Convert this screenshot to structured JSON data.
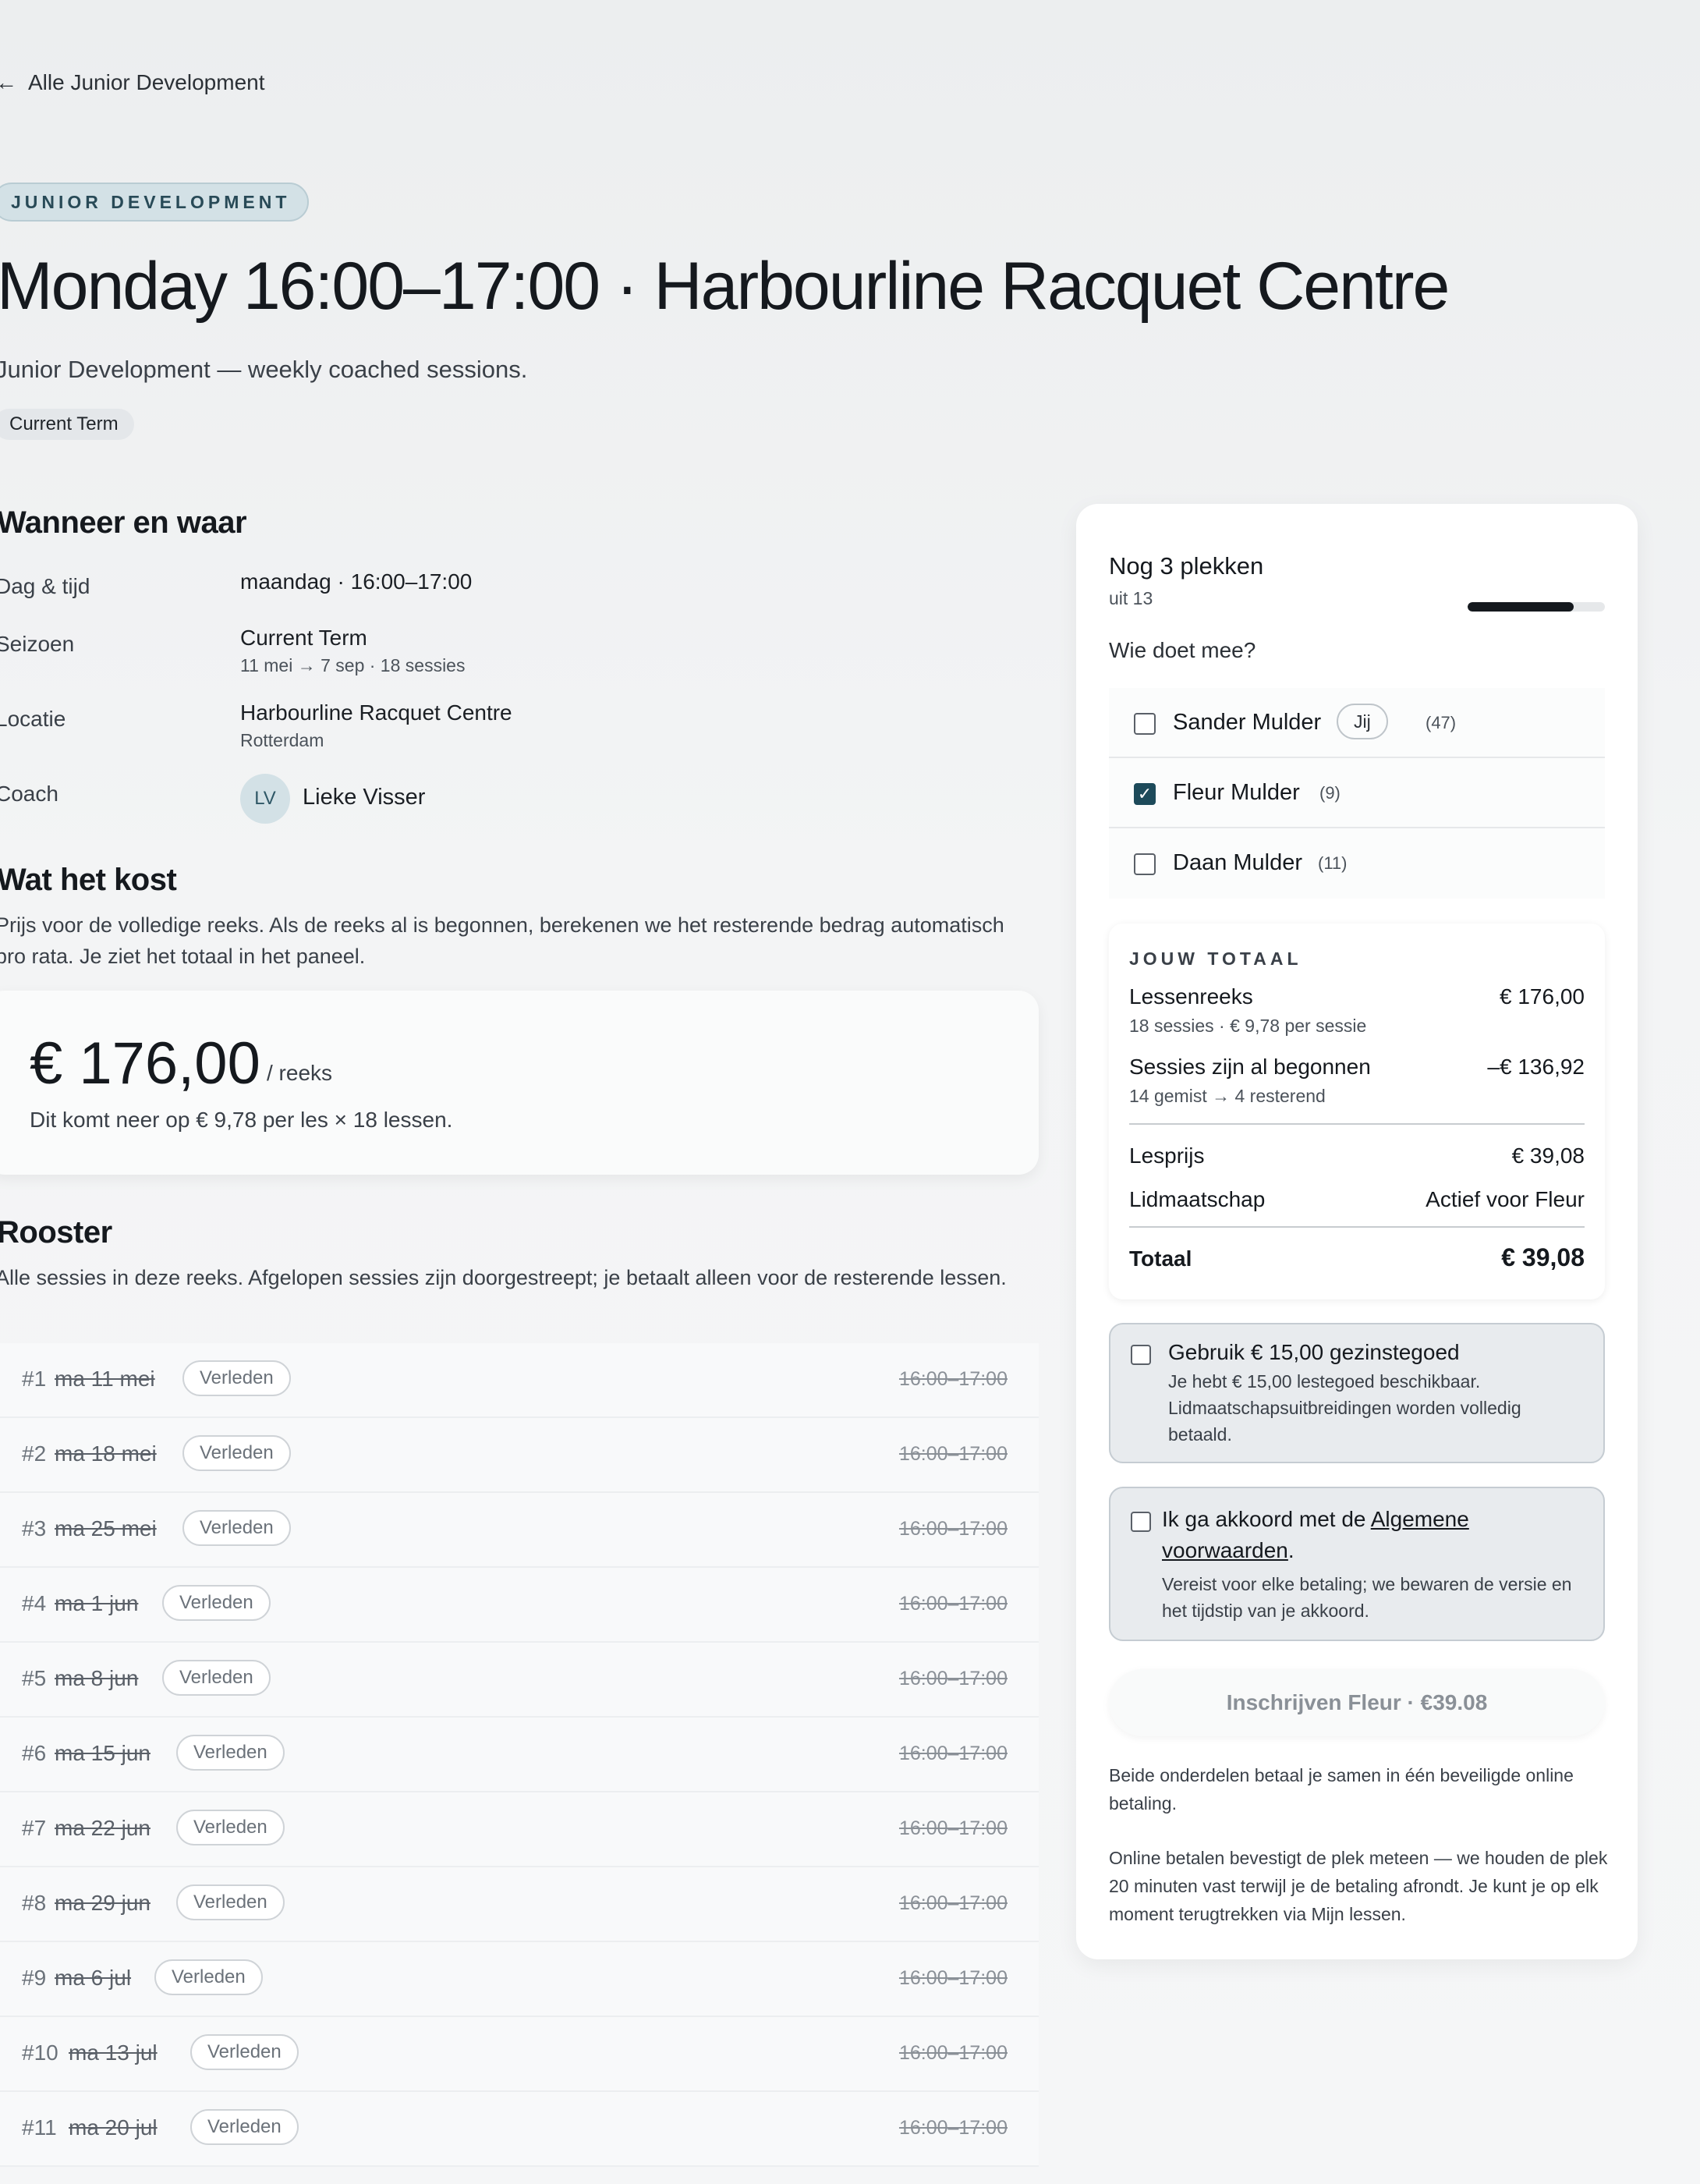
{
  "nav": {
    "back_label": "Alle Junior Development"
  },
  "header": {
    "eyebrow": "JUNIOR DEVELOPMENT",
    "title": "Monday 16:00–17:00 · Harbourline Racquet Centre",
    "subtitle": "Junior Development — weekly coached sessions.",
    "term_chip": "Current Term"
  },
  "when_where": {
    "heading": "Wanneer en waar",
    "day_label": "Dag & tijd",
    "day_value": "maandag · 16:00–17:00",
    "season_label": "Seizoen",
    "season_value": "Current Term",
    "season_sub": "11 mei → 7 sep · 18 sessies",
    "location_label": "Locatie",
    "location_value": "Harbourline Racquet Centre",
    "location_sub": "Rotterdam",
    "coach_label": "Coach",
    "coach_initials": "LV",
    "coach_name": "Lieke Visser"
  },
  "cost": {
    "heading": "Wat het kost",
    "description": "Prijs voor de volledige reeks. Als de reeks al is begonnen, berekenen we het resterende bedrag automatisch pro rata. Je ziet het totaal in het paneel.",
    "price": "€ 176,00",
    "unit": "/ reeks",
    "note": "Dit komt neer op € 9,78 per les × 18 lessen."
  },
  "schedule": {
    "heading": "Rooster",
    "description": "Alle sessies in deze reeks. Afgelopen sessies zijn doorgestreept; je betaalt alleen voor de resterende lessen.",
    "rows": [
      {
        "num": "#1",
        "date": "ma 11 mei",
        "badge": "Verleden",
        "time": "16:00–17:00"
      },
      {
        "num": "#2",
        "date": "ma 18 mei",
        "badge": "Verleden",
        "time": "16:00–17:00"
      },
      {
        "num": "#3",
        "date": "ma 25 mei",
        "badge": "Verleden",
        "time": "16:00–17:00"
      },
      {
        "num": "#4",
        "date": "ma 1 jun",
        "badge": "Verleden",
        "time": "16:00–17:00"
      },
      {
        "num": "#5",
        "date": "ma 8 jun",
        "badge": "Verleden",
        "time": "16:00–17:00"
      },
      {
        "num": "#6",
        "date": "ma 15 jun",
        "badge": "Verleden",
        "time": "16:00–17:00"
      },
      {
        "num": "#7",
        "date": "ma 22 jun",
        "badge": "Verleden",
        "time": "16:00–17:00"
      },
      {
        "num": "#8",
        "date": "ma 29 jun",
        "badge": "Verleden",
        "time": "16:00–17:00"
      },
      {
        "num": "#9",
        "date": "ma 6 jul",
        "badge": "Verleden",
        "time": "16:00–17:00"
      },
      {
        "num": "#10",
        "date": "ma 13 jul",
        "badge": "Verleden",
        "time": "16:00–17:00"
      },
      {
        "num": "#11",
        "date": "ma 20 jul",
        "badge": "Verleden",
        "time": "16:00–17:00"
      }
    ]
  },
  "panel": {
    "spots_title": "Nog 3 plekken",
    "spots_sub": "uit 13",
    "spots_fill_fraction": 0.77,
    "who_label": "Wie doet mee?",
    "members": [
      {
        "name": "Sander Mulder",
        "tag": "Jij",
        "age": "(47)",
        "checked": false
      },
      {
        "name": "Fleur Mulder",
        "tag": "",
        "age": "(9)",
        "checked": true
      },
      {
        "name": "Daan Mulder",
        "tag": "",
        "age": "(11)",
        "checked": false
      }
    ],
    "total": {
      "eyebrow": "JOUW TOTAAL",
      "series_label": "Lessenreeks",
      "series_value": "€ 176,00",
      "series_sub": "18 sessies · € 9,78 per sessie",
      "started_label": "Sessies zijn al begonnen",
      "started_value": "–€ 136,92",
      "started_sub": "14 gemist → 4 resterend",
      "lesson_label": "Lesprijs",
      "lesson_value": "€ 39,08",
      "membership_label": "Lidmaatschap",
      "membership_value": "Actief voor Fleur",
      "total_label": "Totaal",
      "total_value": "€ 39,08"
    },
    "credit": {
      "title": "Gebruik € 15,00 gezinstegoed",
      "text": "Je hebt € 15,00 lestegoed beschikbaar. Lidmaatschapsuitbreidingen worden volledig betaald."
    },
    "terms": {
      "prefix": "Ik ga akkoord met de ",
      "link": "Algemene voorwaarden",
      "suffix": ".",
      "text": "Vereist voor elke betaling; we bewaren de versie en het tijdstip van je akkoord."
    },
    "cta_label": "Inschrijven Fleur · €39.08",
    "footer_1": "Beide onderdelen betaal je samen in één beveiligde online betaling.",
    "footer_2": "Online betalen bevestigt de plek meteen — we houden de plek 20 minuten vast terwijl je de betaling afrondt. Je kunt je op elk moment terugtrekken via Mijn lessen."
  }
}
